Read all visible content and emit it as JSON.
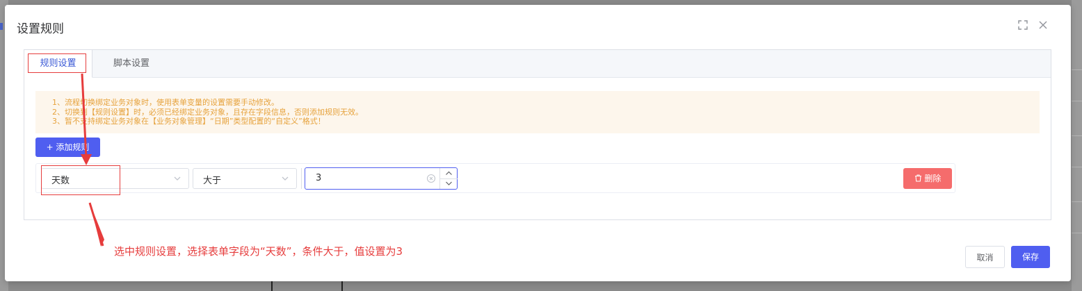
{
  "dialog": {
    "title": "设置规则",
    "tabs": [
      {
        "label": "规则设置",
        "active": true
      },
      {
        "label": "脚本设置",
        "active": false
      }
    ],
    "notice": [
      "1、流程切换绑定业务对象时，使用表单变量的设置需要手动修改。",
      "2、切换到【规则设置】时，必须已经绑定业务对象，且存在字段信息，否则添加规则无效。",
      "3、暂不支持绑定业务对象在【业务对象管理】“日期”类型配置的“自定义”格式！"
    ],
    "add_rule_label": "+ 添加规则",
    "rule": {
      "field": "天数",
      "operator": "大于",
      "value": "3",
      "delete_label": "删除"
    },
    "cancel_label": "取消",
    "save_label": "保存"
  },
  "annotation": "选中规则设置，选择表单字段为“天数”，条件大于，值设置为3",
  "colors": {
    "primary": "#4f5ef0",
    "danger": "#f56c6c",
    "warning_text": "#e6a23c",
    "warning_bg": "#fdf6ec",
    "annotation": "#e63c3c"
  },
  "icons": {
    "fullscreen": "fullscreen-icon",
    "close": "close-icon",
    "chevron": "chevron-down-icon",
    "clear": "clear-circle-icon",
    "delete": "trash-icon"
  }
}
